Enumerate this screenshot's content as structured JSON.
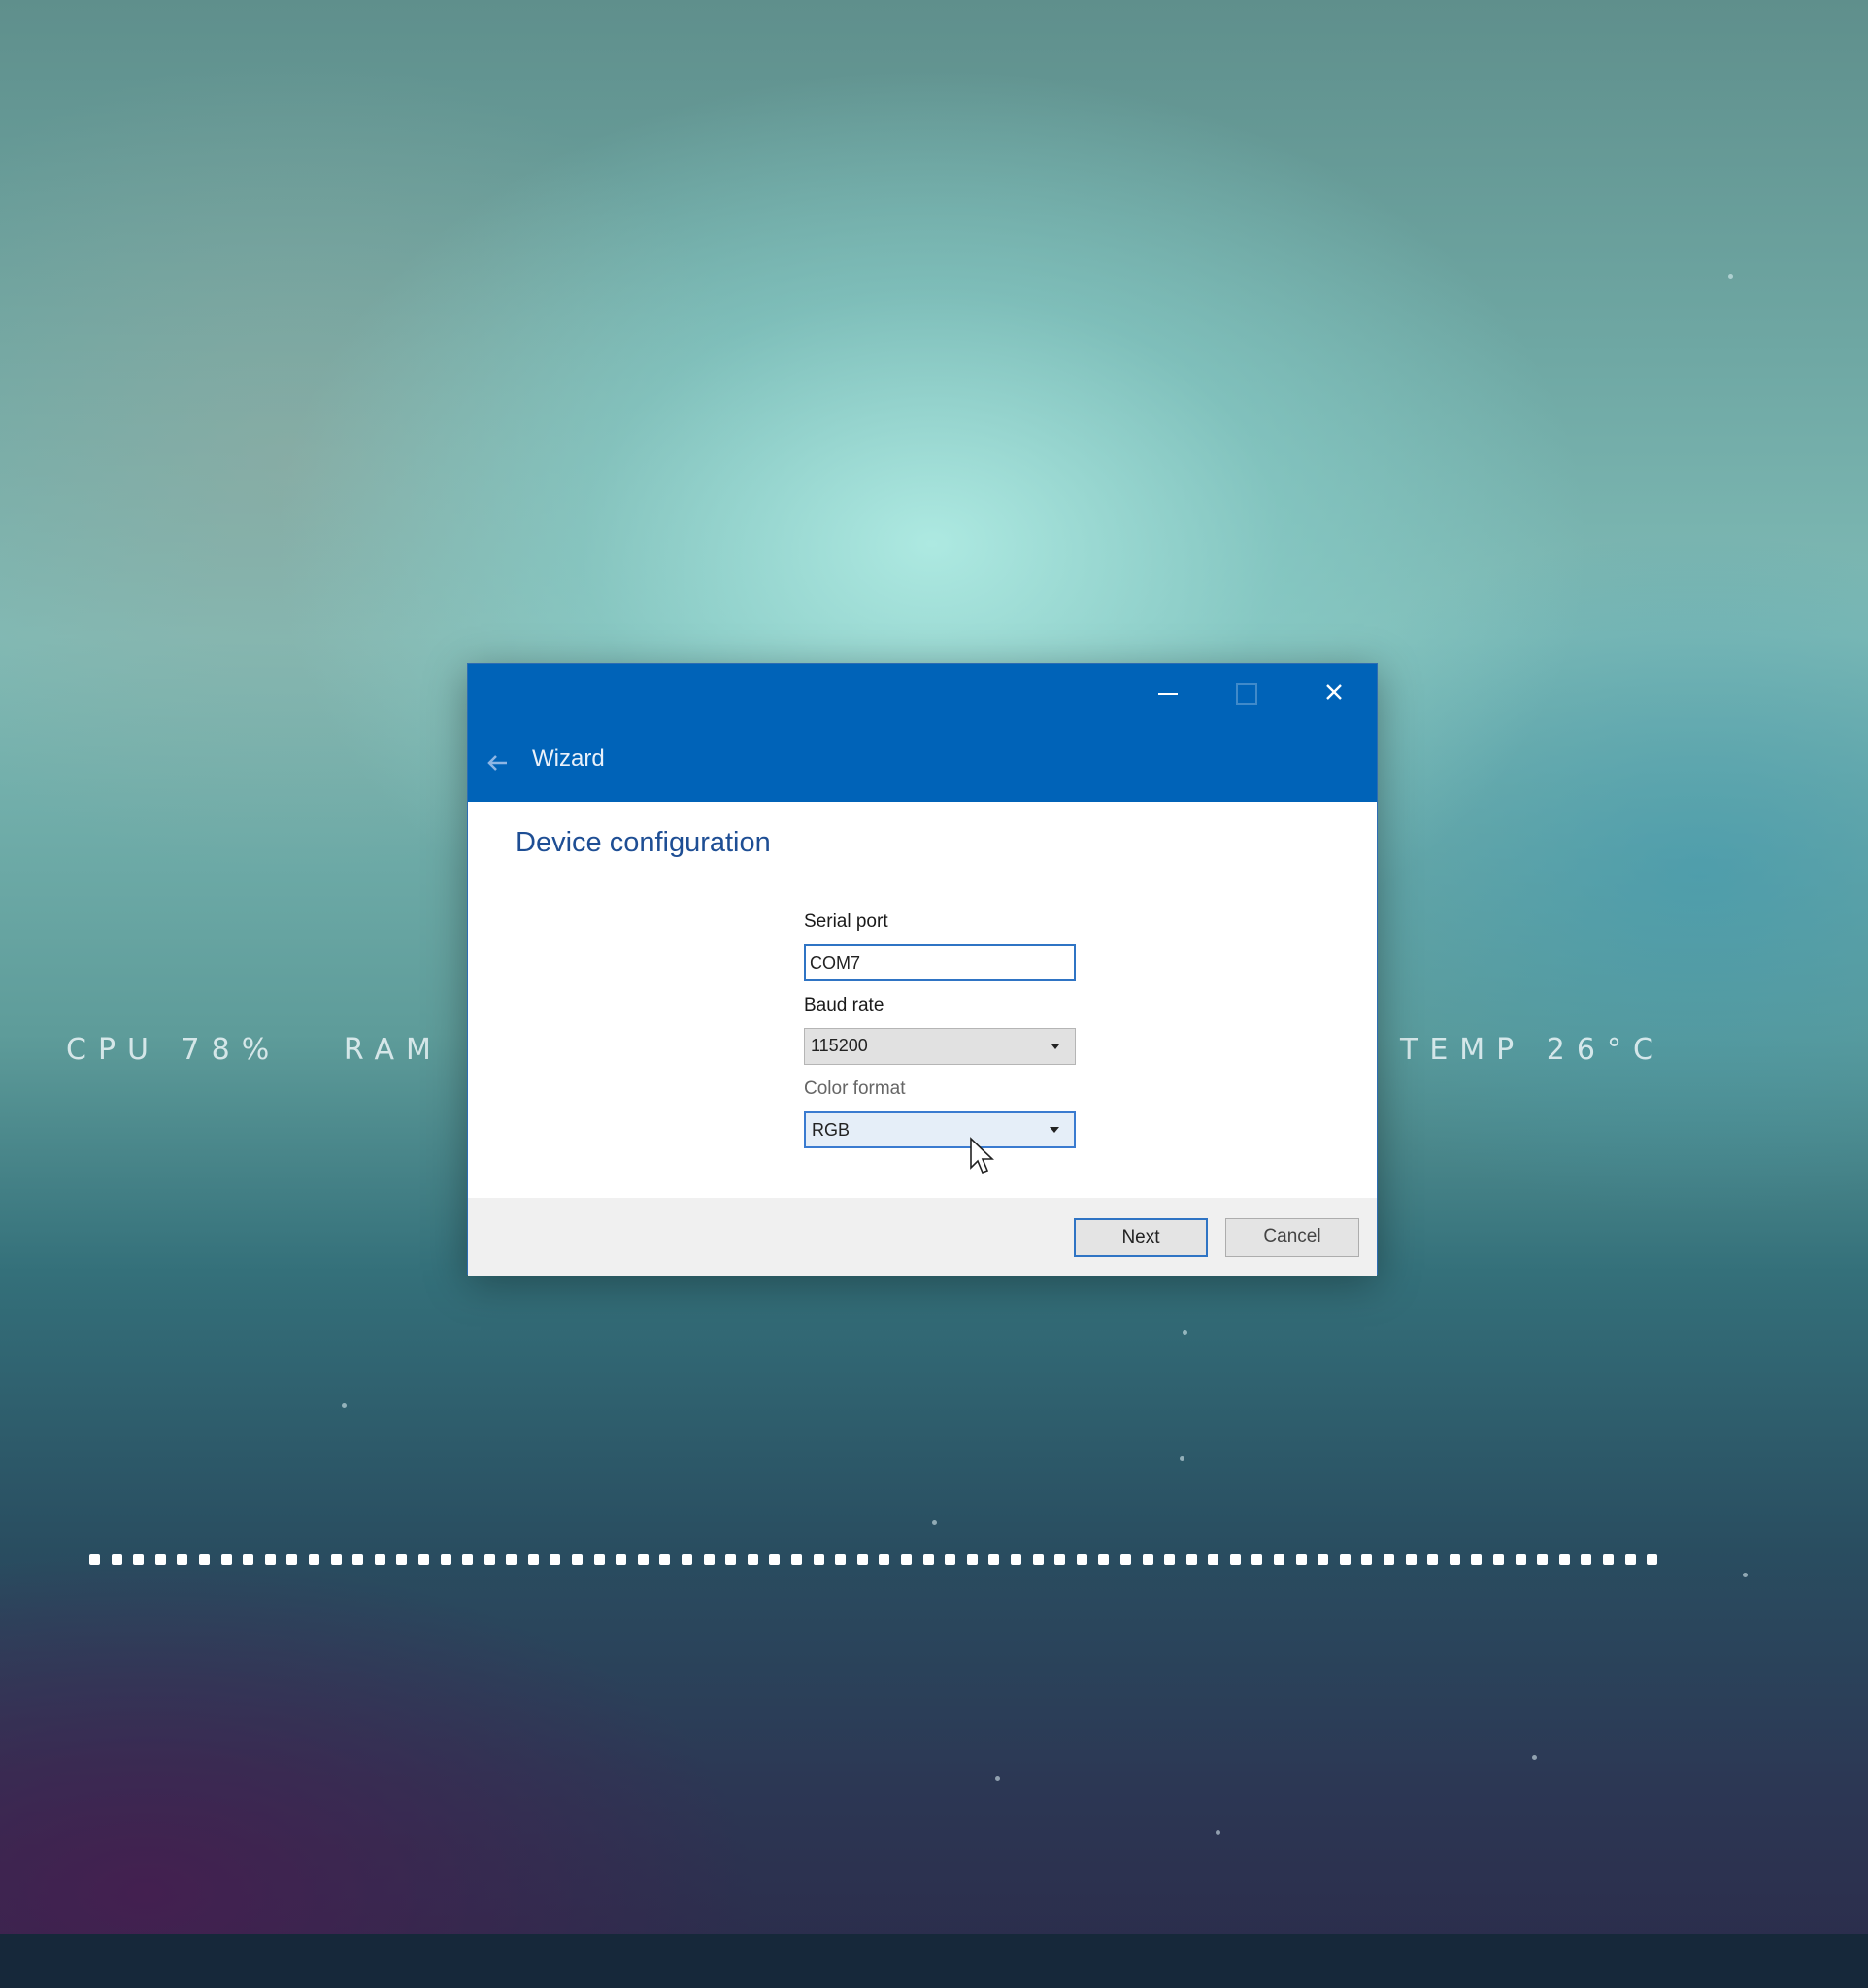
{
  "desktop": {
    "hud_left": "CPU 78%   RAM",
    "hud_right": "TEMP 26°C"
  },
  "dialog": {
    "window_title": "Wizard",
    "heading": "Device configuration",
    "serial_port": {
      "label": "Serial port",
      "value": "COM7"
    },
    "baud_rate": {
      "label": "Baud rate",
      "selected": "115200"
    },
    "color_format": {
      "label": "Color format",
      "selected": "RGB"
    },
    "buttons": {
      "next": "Next",
      "cancel": "Cancel"
    }
  },
  "colors": {
    "titlebar": "#0063b8",
    "heading": "#1e4e94",
    "focus_border": "#2f74c4",
    "footer": "#f0f0f0"
  }
}
